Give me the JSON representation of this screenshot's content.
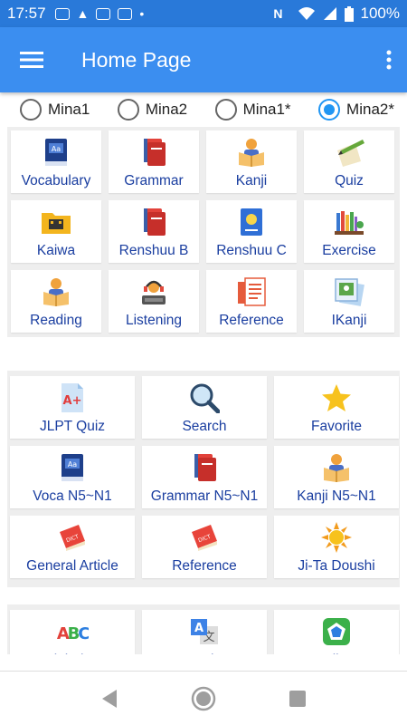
{
  "status_bar": {
    "time": "17:57",
    "battery": "100%"
  },
  "app_bar": {
    "title": "Home Page"
  },
  "radios": [
    {
      "label": "Mina1",
      "selected": false
    },
    {
      "label": "Mina2",
      "selected": false
    },
    {
      "label": "Mina1*",
      "selected": false
    },
    {
      "label": "Mina2*",
      "selected": true
    }
  ],
  "grid1": [
    {
      "label": "Vocabulary",
      "icon": "book-icon"
    },
    {
      "label": "Grammar",
      "icon": "books-icon"
    },
    {
      "label": "Kanji",
      "icon": "reader-icon"
    },
    {
      "label": "Quiz",
      "icon": "pencil-paper-icon"
    },
    {
      "label": "Kaiwa",
      "icon": "film-folder-icon"
    },
    {
      "label": "Renshuu B",
      "icon": "books-icon"
    },
    {
      "label": "Renshuu C",
      "icon": "notebook-icon"
    },
    {
      "label": "Exercise",
      "icon": "bookshelf-icon"
    },
    {
      "label": "Reading",
      "icon": "reader-icon"
    },
    {
      "label": "Listening",
      "icon": "headphones-icon"
    },
    {
      "label": "Reference",
      "icon": "document-icon"
    },
    {
      "label": "IKanji",
      "icon": "photo-icon"
    }
  ],
  "grid2": [
    {
      "label": "JLPT Quiz",
      "icon": "grade-paper-icon"
    },
    {
      "label": "Search",
      "icon": "magnifier-icon"
    },
    {
      "label": "Favorite",
      "icon": "star-icon"
    },
    {
      "label": "Voca N5~N1",
      "icon": "book-icon"
    },
    {
      "label": "Grammar N5~N1",
      "icon": "books-icon"
    },
    {
      "label": "Kanji N5~N1",
      "icon": "reader-icon"
    },
    {
      "label": "General Article",
      "icon": "red-book-icon"
    },
    {
      "label": "Reference",
      "icon": "red-book-icon"
    },
    {
      "label": "Ji-Ta Doushi",
      "icon": "sun-icon"
    }
  ],
  "grid3": [
    {
      "label": "Alphabet",
      "icon": "abc-icon"
    },
    {
      "label": "Translate",
      "icon": "translate-icon"
    },
    {
      "label": "Kanji Out",
      "icon": "pentagon-icon"
    }
  ]
}
